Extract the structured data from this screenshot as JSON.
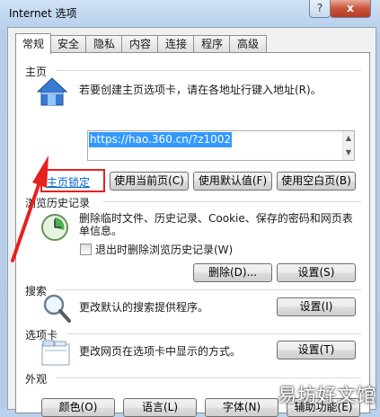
{
  "window": {
    "title": "Internet 选项",
    "help_label": "?",
    "close_label": "x"
  },
  "tabs": [
    {
      "label": "常规"
    },
    {
      "label": "安全"
    },
    {
      "label": "隐私"
    },
    {
      "label": "内容"
    },
    {
      "label": "连接"
    },
    {
      "label": "程序"
    },
    {
      "label": "高级"
    }
  ],
  "home": {
    "title": "主页",
    "description": "若要创建主页选项卡，请在各地址行键入地址(R)。",
    "url": "https://hao.360.cn/?z1002",
    "lock_link": "主页锁定",
    "use_current": "使用当前页(C)",
    "use_default": "使用默认值(F)",
    "use_blank": "使用空白页(B)"
  },
  "history": {
    "title": "浏览历史记录",
    "description": "删除临时文件、历史记录、Cookie、保存的密码和网页表单信息。",
    "checkbox_label": "退出时删除浏览历史记录(W)",
    "delete_button": "删除(D)...",
    "settings_button": "设置(S)"
  },
  "search": {
    "title": "搜索",
    "description": "更改默认的搜索提供程序。",
    "settings_button": "设置(I)"
  },
  "tabsec": {
    "title": "选项卡",
    "description": "更改网页在选项卡中显示的方式。",
    "settings_button": "设置(T)"
  },
  "appearance": {
    "title": "外观",
    "colors_button": "颜色(O)",
    "languages_button": "语言(L)",
    "fonts_button": "字体(N)",
    "accessibility_button": "辅助功能(E)"
  },
  "watermark": "易坊好文馆"
}
